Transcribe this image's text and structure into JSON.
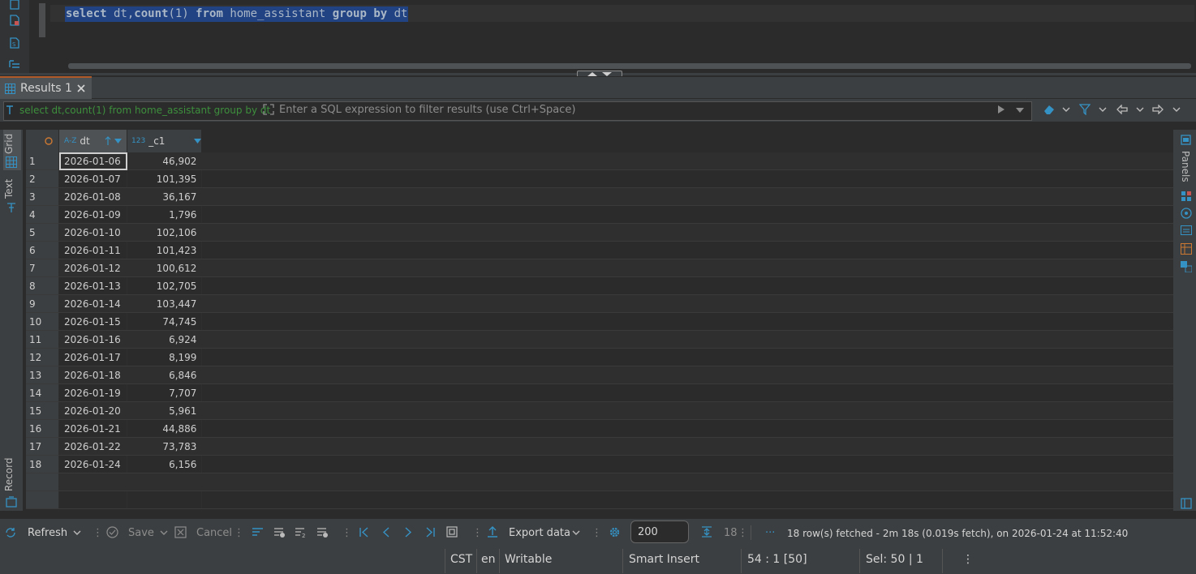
{
  "editor": {
    "sql_parts": [
      {
        "text": "select",
        "kind": "kw"
      },
      {
        "text": " dt,",
        "kind": "plain"
      },
      {
        "text": "count",
        "kind": "kw"
      },
      {
        "text": "(1) ",
        "kind": "plain"
      },
      {
        "text": "from",
        "kind": "kw"
      },
      {
        "text": " home_assistant ",
        "kind": "plain"
      },
      {
        "text": "group by",
        "kind": "kw"
      },
      {
        "text": " dt",
        "kind": "plain"
      }
    ]
  },
  "results_tab": {
    "label": "Results 1"
  },
  "filter": {
    "current_query": "select dt,count(1) from home_assistant group by dt",
    "placeholder": "Enter a SQL expression to filter results (use Ctrl+Space)"
  },
  "side_tabs": {
    "grid": "Grid",
    "text": "Text",
    "record": "Record",
    "panels": "Panels"
  },
  "table": {
    "columns": [
      {
        "type_badge": "A-Z",
        "name": "dt"
      },
      {
        "type_badge": "123",
        "name": "_c1"
      }
    ],
    "rows": [
      {
        "n": "1",
        "dt": "2026-01-06",
        "c1": "46,902"
      },
      {
        "n": "2",
        "dt": "2026-01-07",
        "c1": "101,395"
      },
      {
        "n": "3",
        "dt": "2026-01-08",
        "c1": "36,167"
      },
      {
        "n": "4",
        "dt": "2026-01-09",
        "c1": "1,796"
      },
      {
        "n": "5",
        "dt": "2026-01-10",
        "c1": "102,106"
      },
      {
        "n": "6",
        "dt": "2026-01-11",
        "c1": "101,423"
      },
      {
        "n": "7",
        "dt": "2026-01-12",
        "c1": "100,612"
      },
      {
        "n": "8",
        "dt": "2026-01-13",
        "c1": "102,705"
      },
      {
        "n": "9",
        "dt": "2026-01-14",
        "c1": "103,447"
      },
      {
        "n": "10",
        "dt": "2026-01-15",
        "c1": "74,745"
      },
      {
        "n": "11",
        "dt": "2026-01-16",
        "c1": "6,924"
      },
      {
        "n": "12",
        "dt": "2026-01-17",
        "c1": "8,199"
      },
      {
        "n": "13",
        "dt": "2026-01-18",
        "c1": "6,846"
      },
      {
        "n": "14",
        "dt": "2026-01-19",
        "c1": "7,707"
      },
      {
        "n": "15",
        "dt": "2026-01-20",
        "c1": "5,961"
      },
      {
        "n": "16",
        "dt": "2026-01-21",
        "c1": "44,886"
      },
      {
        "n": "17",
        "dt": "2026-01-22",
        "c1": "73,783"
      },
      {
        "n": "18",
        "dt": "2026-01-24",
        "c1": "6,156"
      }
    ]
  },
  "toolbar": {
    "refresh": "Refresh",
    "save": "Save",
    "cancel": "Cancel",
    "export": "Export data",
    "page_size": "200",
    "row_count": "18",
    "fetch_status": "18 row(s) fetched - 2m 18s (0.019s fetch), on 2026-01-24 at 11:52:40"
  },
  "statusbar": {
    "timezone": "CST",
    "locale": "en",
    "mode": "Writable",
    "insert_mode": "Smart Insert",
    "cursor": "54 : 1 [50]",
    "selection": "Sel: 50 | 1"
  },
  "colors": {
    "keyword": "#cc7832",
    "selection": "#214283",
    "filter_text": "#3d8f3d",
    "accent": "#3592c4"
  },
  "icons": [
    "sql-file-icon",
    "script-error-icon",
    "script-icon",
    "outline-icon",
    "table-icon",
    "close-icon",
    "filter-history-icon",
    "expand-icon",
    "run-filter-icon",
    "eraser-icon",
    "filter-icon",
    "back-icon",
    "forward-icon",
    "grid-icon",
    "text-icon",
    "record-icon",
    "panels-icon",
    "refresh-icon",
    "save-icon",
    "cancel-icon",
    "first-page-icon",
    "prev-page-icon",
    "next-page-icon",
    "last-page-icon",
    "export-icon",
    "settings-icon",
    "fetch-all-icon"
  ]
}
